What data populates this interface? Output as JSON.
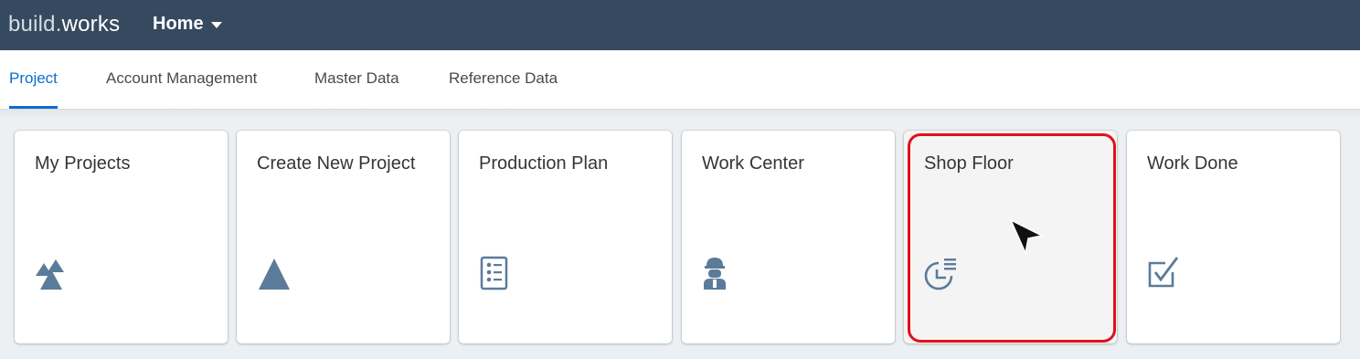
{
  "shell": {
    "brand_part1": "build",
    "brand_dot": ".",
    "brand_part2": "works",
    "home_label": "Home"
  },
  "tabs": [
    {
      "label": "Project",
      "active": true
    },
    {
      "label": "Account Management",
      "active": false
    },
    {
      "label": "Master Data",
      "active": false
    },
    {
      "label": "Reference Data",
      "active": false
    }
  ],
  "tiles": [
    {
      "title": "My Projects",
      "icon": "mountains-icon"
    },
    {
      "title": "Create New Project",
      "icon": "triangle-icon"
    },
    {
      "title": "Production Plan",
      "icon": "checklist-icon"
    },
    {
      "title": "Work Center",
      "icon": "worker-icon"
    },
    {
      "title": "Shop Floor",
      "icon": "process-chart-icon",
      "highlighted": true
    },
    {
      "title": "Work Done",
      "icon": "checkbox-icon"
    }
  ],
  "colors": {
    "shell_bg": "#354a5f",
    "accent": "#0a6ed1",
    "icon": "#5b7b9a",
    "highlight": "#e0101a"
  }
}
